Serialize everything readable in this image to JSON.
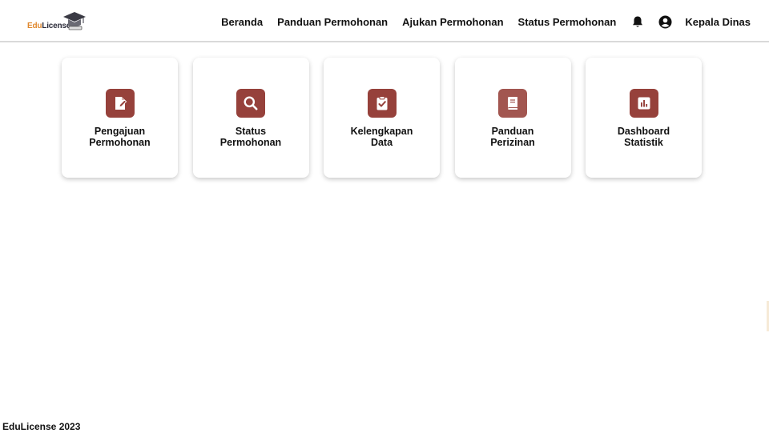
{
  "brand": {
    "logo_part1": "Edu",
    "logo_part2": "License",
    "accent_color": "#96413b"
  },
  "nav": {
    "links": [
      {
        "label": "Beranda"
      },
      {
        "label": "Panduan Permohonan"
      },
      {
        "label": "Ajukan Permohonan"
      },
      {
        "label": "Status Permohonan"
      }
    ],
    "notification_icon": "bell-icon",
    "user_icon": "user-circle-icon",
    "user_name": "Kepala Dinas"
  },
  "cards": [
    {
      "line1": "Pengajuan",
      "line2": "Permohonan",
      "icon": "edit-document-icon"
    },
    {
      "line1": "Status",
      "line2": "Permohonan",
      "icon": "search-icon"
    },
    {
      "line1": "Kelengkapan",
      "line2": "Data",
      "icon": "clipboard-check-icon"
    },
    {
      "line1": "Panduan",
      "line2": "Perizinan",
      "icon": "book-icon"
    },
    {
      "line1": "Dashboard",
      "line2": "Statistik",
      "icon": "bar-chart-icon"
    }
  ],
  "footer": {
    "text": "EduLicense 2023"
  }
}
